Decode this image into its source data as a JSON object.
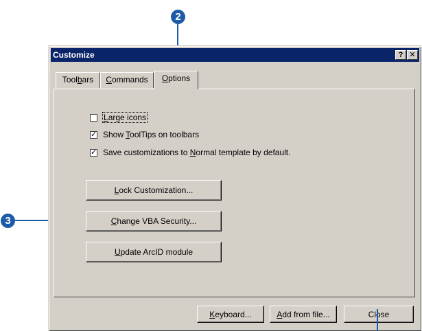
{
  "callouts": {
    "top": "2",
    "left": "3"
  },
  "dialog": {
    "title": "Customize",
    "help_button": "?",
    "close_x": "✕"
  },
  "tabs": [
    {
      "label_pre": "Tool",
      "label_u": "b",
      "label_post": "ars"
    },
    {
      "label_pre": "",
      "label_u": "C",
      "label_post": "ommands"
    },
    {
      "label_pre": "",
      "label_u": "O",
      "label_post": "ptions"
    }
  ],
  "options": {
    "large_icons": {
      "pre": "",
      "u": "L",
      "post": "arge icons",
      "checked": false
    },
    "tooltips": {
      "pre": "Show ",
      "u": "T",
      "post": "oolTips on toolbars",
      "checked": true
    },
    "save_custom": {
      "pre": "Save customizations to ",
      "u": "N",
      "post": "ormal template by default.",
      "checked": true
    }
  },
  "buttons": {
    "lock": {
      "pre": "",
      "u": "L",
      "post": "ock Customization..."
    },
    "vba": {
      "pre": "",
      "u": "C",
      "post": "hange VBA Security..."
    },
    "arcid": {
      "pre": "",
      "u": "U",
      "post": "pdate ArcID module"
    },
    "keyboard": {
      "pre": "",
      "u": "K",
      "post": "eyboard..."
    },
    "add_file": {
      "pre": "",
      "u": "A",
      "post": "dd from file..."
    },
    "close": "Close"
  }
}
